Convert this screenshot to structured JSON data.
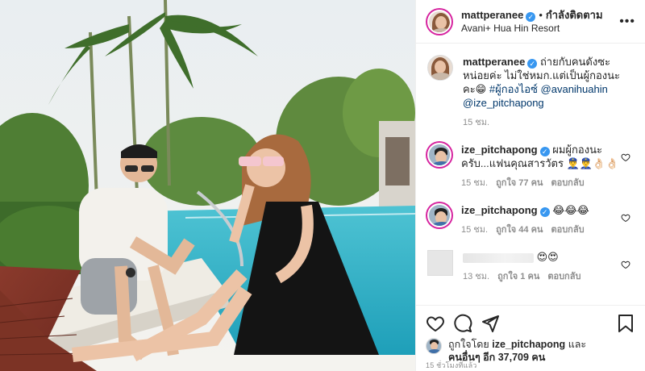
{
  "header": {
    "username": "mattperanee",
    "separator": "•",
    "follow_status": "กำลังติดตาม",
    "location": "Avani+ Hua Hin Resort",
    "more_label": "•••"
  },
  "caption": {
    "username": "mattperanee",
    "text": "ถ่ายกับคนดังซะหน่อยค่ะ ไม่ใช่หมก.แต่เป็นผู้กองนะคะ😁",
    "hashtag": "#ผู้กองไอซ์",
    "mention1": "@avanihuahin",
    "mention2": "@ize_pitchapong",
    "time": "15 ชม."
  },
  "comments": [
    {
      "username": "ize_pitchapong",
      "text": "ผมผู้กองนะครับ...แฟนคุณสารวัตร 👮‍♂️👮‍♂️👌🏻👌🏻",
      "time": "15 ชม.",
      "likes": "ถูกใจ 77 คน",
      "reply": "ตอบกลับ"
    },
    {
      "username": "ize_pitchapong",
      "text": "😂😂😂",
      "time": "15 ชม.",
      "likes": "ถูกใจ 44 คน",
      "reply": "ตอบกลับ"
    },
    {
      "username": "",
      "text": "😍😍",
      "time": "13 ชม.",
      "likes": "ถูกใจ 1 คน",
      "reply": "ตอบกลับ"
    }
  ],
  "likes": {
    "prefix": "ถูกใจโดย",
    "username": "ize_pitchapong",
    "and": "และ",
    "others": "คนอื่นๆ อีก 37,709 คน"
  },
  "posted_ago": "15 ชั่วโมงที่แล้ว",
  "icons": {
    "verified": "verified-badge",
    "like": "heart-icon",
    "comment": "comment-icon",
    "share": "share-icon",
    "save": "bookmark-icon"
  },
  "colors": {
    "link": "#00376b",
    "verified": "#3897f0",
    "muted": "#8e8e8e",
    "story_ring": "#d6249f"
  }
}
